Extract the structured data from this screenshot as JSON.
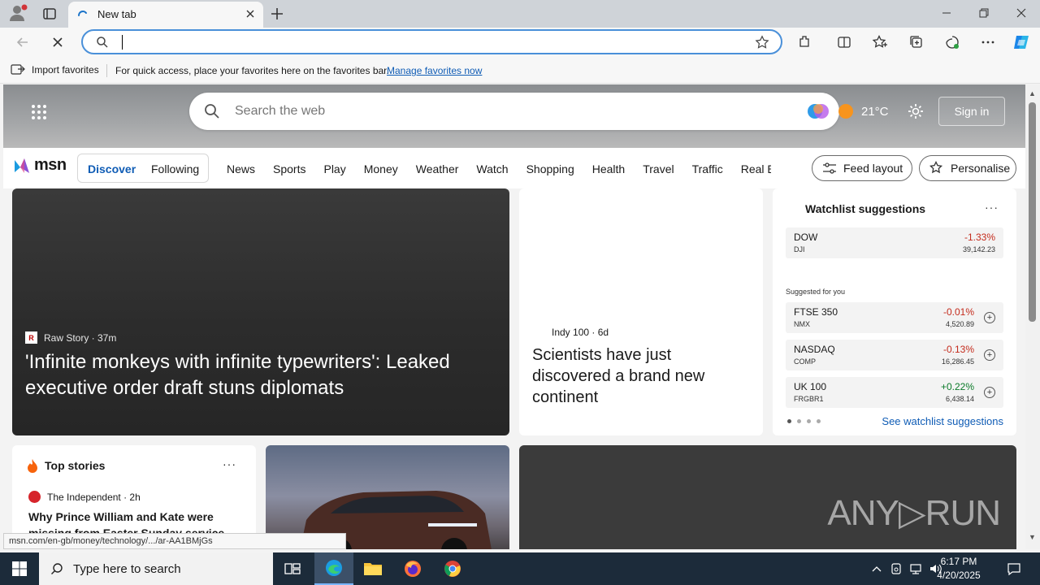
{
  "browser": {
    "tab_title": "New tab",
    "address_placeholder": "",
    "favorites_bar": {
      "import_label": "Import favorites",
      "message": "For quick access, place your favorites here on the favorites bar.",
      "manage_link": "Manage favorites now"
    },
    "status_url": "msn.com/en-gb/money/technology/.../ar-AA1BMjGs"
  },
  "msn": {
    "search_placeholder": "Search the web",
    "weather_temp": "21°C",
    "sign_in": "Sign in",
    "logo_text": "msn",
    "discover": "Discover",
    "following": "Following",
    "categories": [
      "News",
      "Sports",
      "Play",
      "Money",
      "Weather",
      "Watch",
      "Shopping",
      "Health",
      "Travel",
      "Traffic",
      "Real E"
    ],
    "feed_layout": "Feed layout",
    "personalise": "Personalise"
  },
  "hero": {
    "source": "Raw Story · 37m",
    "source_logo": "R",
    "title": "'Infinite monkeys with infinite typewriters': Leaked executive order draft stuns diplomats"
  },
  "science": {
    "source": "Indy 100 · 6d",
    "title": "Scientists have just discovered a brand new continent"
  },
  "watchlist": {
    "title": "Watchlist suggestions",
    "more": "···",
    "main": {
      "name": "DOW",
      "sub": "DJI",
      "change": "-1.33%",
      "price": "39,142.23"
    },
    "suggested_label": "Suggested for you",
    "suggested": [
      {
        "name": "FTSE 350",
        "sub": "NMX",
        "change": "-0.01%",
        "price": "4,520.89"
      },
      {
        "name": "NASDAQ",
        "sub": "COMP",
        "change": "-0.13%",
        "price": "16,286.45"
      },
      {
        "name": "UK 100",
        "sub": "FRGBR1",
        "change": "+0.22%",
        "price": "6,438.14"
      }
    ],
    "see_all": "See watchlist suggestions"
  },
  "top_stories": {
    "title": "Top stories",
    "more": "···",
    "source": "The Independent · 2h",
    "headline": "Why Prince William and Kate were missing from Easter Sunday service"
  },
  "watermark": "ANY▷RUN",
  "taskbar": {
    "search_placeholder": "Type here to search",
    "time": "6:17 PM",
    "date": "4/20/2025"
  },
  "colors": {
    "accent": "#0f5cb5",
    "negative": "#c42b1c",
    "positive": "#0b7a29",
    "taskbar": "#1c2b3a"
  }
}
